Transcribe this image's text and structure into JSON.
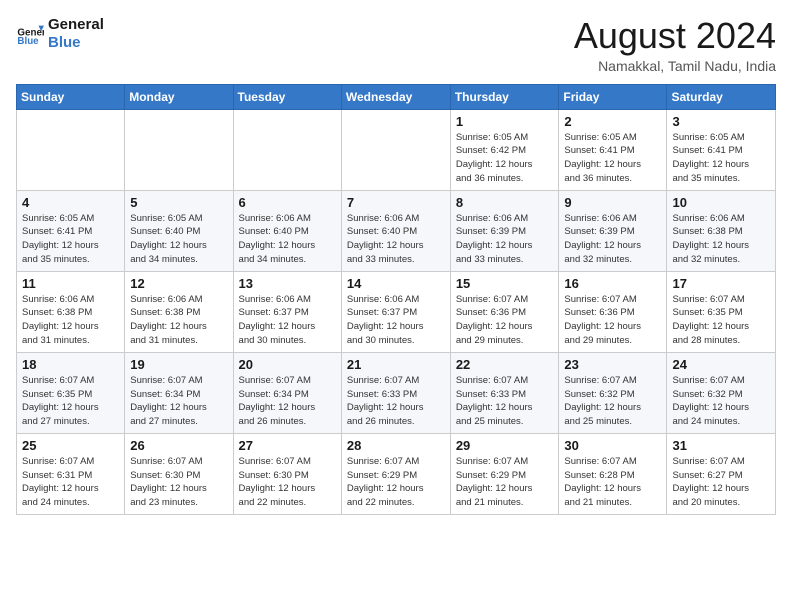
{
  "header": {
    "logo_line1": "General",
    "logo_line2": "Blue",
    "month_year": "August 2024",
    "location": "Namakkal, Tamil Nadu, India"
  },
  "weekdays": [
    "Sunday",
    "Monday",
    "Tuesday",
    "Wednesday",
    "Thursday",
    "Friday",
    "Saturday"
  ],
  "weeks": [
    [
      {
        "day": "",
        "info": ""
      },
      {
        "day": "",
        "info": ""
      },
      {
        "day": "",
        "info": ""
      },
      {
        "day": "",
        "info": ""
      },
      {
        "day": "1",
        "info": "Sunrise: 6:05 AM\nSunset: 6:42 PM\nDaylight: 12 hours\nand 36 minutes."
      },
      {
        "day": "2",
        "info": "Sunrise: 6:05 AM\nSunset: 6:41 PM\nDaylight: 12 hours\nand 36 minutes."
      },
      {
        "day": "3",
        "info": "Sunrise: 6:05 AM\nSunset: 6:41 PM\nDaylight: 12 hours\nand 35 minutes."
      }
    ],
    [
      {
        "day": "4",
        "info": "Sunrise: 6:05 AM\nSunset: 6:41 PM\nDaylight: 12 hours\nand 35 minutes."
      },
      {
        "day": "5",
        "info": "Sunrise: 6:05 AM\nSunset: 6:40 PM\nDaylight: 12 hours\nand 34 minutes."
      },
      {
        "day": "6",
        "info": "Sunrise: 6:06 AM\nSunset: 6:40 PM\nDaylight: 12 hours\nand 34 minutes."
      },
      {
        "day": "7",
        "info": "Sunrise: 6:06 AM\nSunset: 6:40 PM\nDaylight: 12 hours\nand 33 minutes."
      },
      {
        "day": "8",
        "info": "Sunrise: 6:06 AM\nSunset: 6:39 PM\nDaylight: 12 hours\nand 33 minutes."
      },
      {
        "day": "9",
        "info": "Sunrise: 6:06 AM\nSunset: 6:39 PM\nDaylight: 12 hours\nand 32 minutes."
      },
      {
        "day": "10",
        "info": "Sunrise: 6:06 AM\nSunset: 6:38 PM\nDaylight: 12 hours\nand 32 minutes."
      }
    ],
    [
      {
        "day": "11",
        "info": "Sunrise: 6:06 AM\nSunset: 6:38 PM\nDaylight: 12 hours\nand 31 minutes."
      },
      {
        "day": "12",
        "info": "Sunrise: 6:06 AM\nSunset: 6:38 PM\nDaylight: 12 hours\nand 31 minutes."
      },
      {
        "day": "13",
        "info": "Sunrise: 6:06 AM\nSunset: 6:37 PM\nDaylight: 12 hours\nand 30 minutes."
      },
      {
        "day": "14",
        "info": "Sunrise: 6:06 AM\nSunset: 6:37 PM\nDaylight: 12 hours\nand 30 minutes."
      },
      {
        "day": "15",
        "info": "Sunrise: 6:07 AM\nSunset: 6:36 PM\nDaylight: 12 hours\nand 29 minutes."
      },
      {
        "day": "16",
        "info": "Sunrise: 6:07 AM\nSunset: 6:36 PM\nDaylight: 12 hours\nand 29 minutes."
      },
      {
        "day": "17",
        "info": "Sunrise: 6:07 AM\nSunset: 6:35 PM\nDaylight: 12 hours\nand 28 minutes."
      }
    ],
    [
      {
        "day": "18",
        "info": "Sunrise: 6:07 AM\nSunset: 6:35 PM\nDaylight: 12 hours\nand 27 minutes."
      },
      {
        "day": "19",
        "info": "Sunrise: 6:07 AM\nSunset: 6:34 PM\nDaylight: 12 hours\nand 27 minutes."
      },
      {
        "day": "20",
        "info": "Sunrise: 6:07 AM\nSunset: 6:34 PM\nDaylight: 12 hours\nand 26 minutes."
      },
      {
        "day": "21",
        "info": "Sunrise: 6:07 AM\nSunset: 6:33 PM\nDaylight: 12 hours\nand 26 minutes."
      },
      {
        "day": "22",
        "info": "Sunrise: 6:07 AM\nSunset: 6:33 PM\nDaylight: 12 hours\nand 25 minutes."
      },
      {
        "day": "23",
        "info": "Sunrise: 6:07 AM\nSunset: 6:32 PM\nDaylight: 12 hours\nand 25 minutes."
      },
      {
        "day": "24",
        "info": "Sunrise: 6:07 AM\nSunset: 6:32 PM\nDaylight: 12 hours\nand 24 minutes."
      }
    ],
    [
      {
        "day": "25",
        "info": "Sunrise: 6:07 AM\nSunset: 6:31 PM\nDaylight: 12 hours\nand 24 minutes."
      },
      {
        "day": "26",
        "info": "Sunrise: 6:07 AM\nSunset: 6:30 PM\nDaylight: 12 hours\nand 23 minutes."
      },
      {
        "day": "27",
        "info": "Sunrise: 6:07 AM\nSunset: 6:30 PM\nDaylight: 12 hours\nand 22 minutes."
      },
      {
        "day": "28",
        "info": "Sunrise: 6:07 AM\nSunset: 6:29 PM\nDaylight: 12 hours\nand 22 minutes."
      },
      {
        "day": "29",
        "info": "Sunrise: 6:07 AM\nSunset: 6:29 PM\nDaylight: 12 hours\nand 21 minutes."
      },
      {
        "day": "30",
        "info": "Sunrise: 6:07 AM\nSunset: 6:28 PM\nDaylight: 12 hours\nand 21 minutes."
      },
      {
        "day": "31",
        "info": "Sunrise: 6:07 AM\nSunset: 6:27 PM\nDaylight: 12 hours\nand 20 minutes."
      }
    ]
  ]
}
